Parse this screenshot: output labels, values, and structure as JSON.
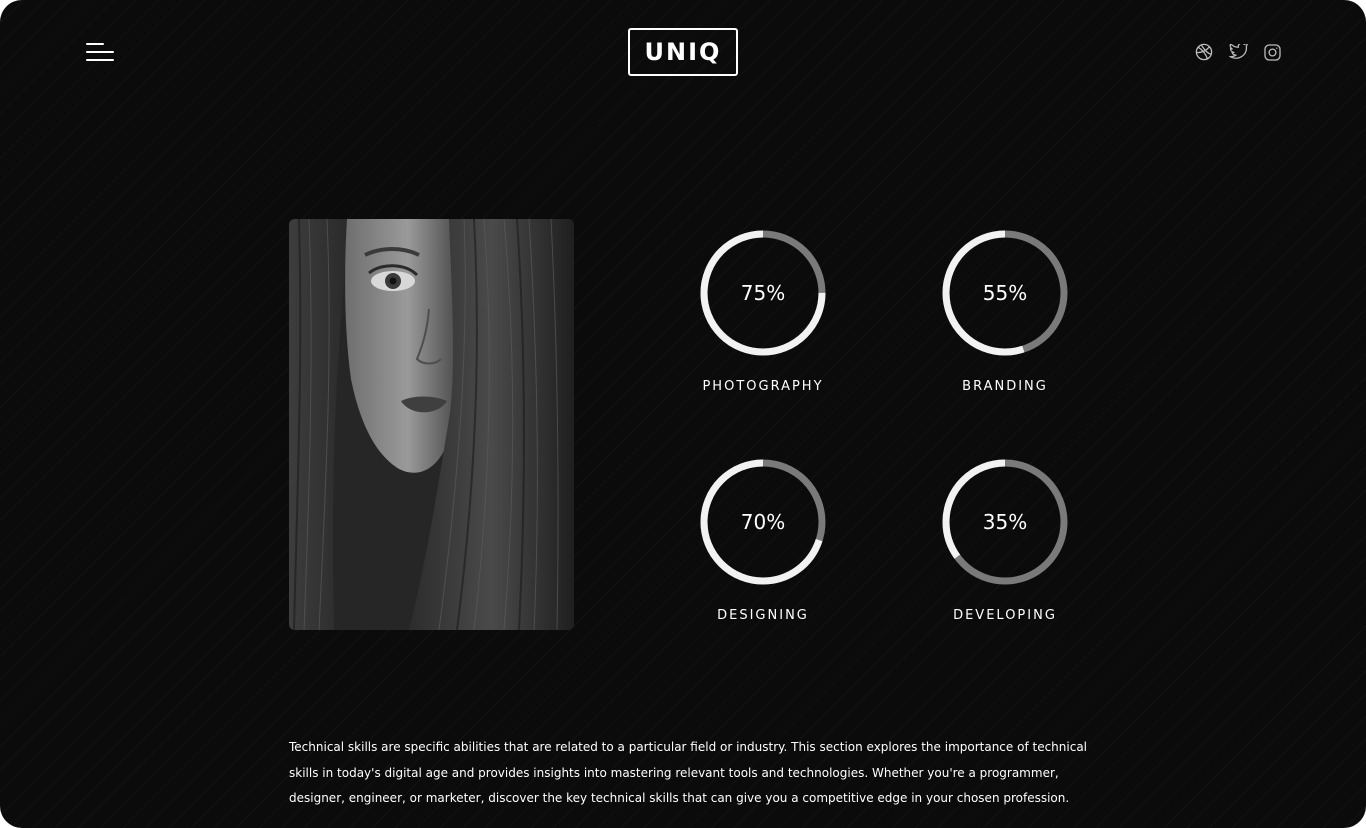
{
  "header": {
    "logo_text": "UNIQ",
    "menu_icon": "hamburger-menu-icon",
    "social_icons": [
      "dribbble-icon",
      "twitter-icon",
      "instagram-icon"
    ]
  },
  "portrait": {
    "description_icon": "portrait-photo"
  },
  "skills": [
    {
      "label": "PHOTOGRAPHY",
      "value_text": "75%",
      "percent": 75
    },
    {
      "label": "BRANDING",
      "value_text": "55%",
      "percent": 55
    },
    {
      "label": "DESIGNING",
      "value_text": "70%",
      "percent": 70
    },
    {
      "label": "DEVELOPING",
      "value_text": "35%",
      "percent": 35
    }
  ],
  "description": {
    "text": "Technical skills are specific abilities that are related to a particular field or industry. This section explores the importance of technical skills in today's digital age and provides insights into mastering relevant tools and technologies. Whether you're a programmer, designer, engineer, or marketer, discover the key technical skills that can give you a competitive edge in your chosen profession."
  },
  "colors": {
    "background": "#0b0b0b",
    "ring_progress": "#f2f2f2",
    "ring_track": "#7a7a7a",
    "text": "#ffffff"
  }
}
